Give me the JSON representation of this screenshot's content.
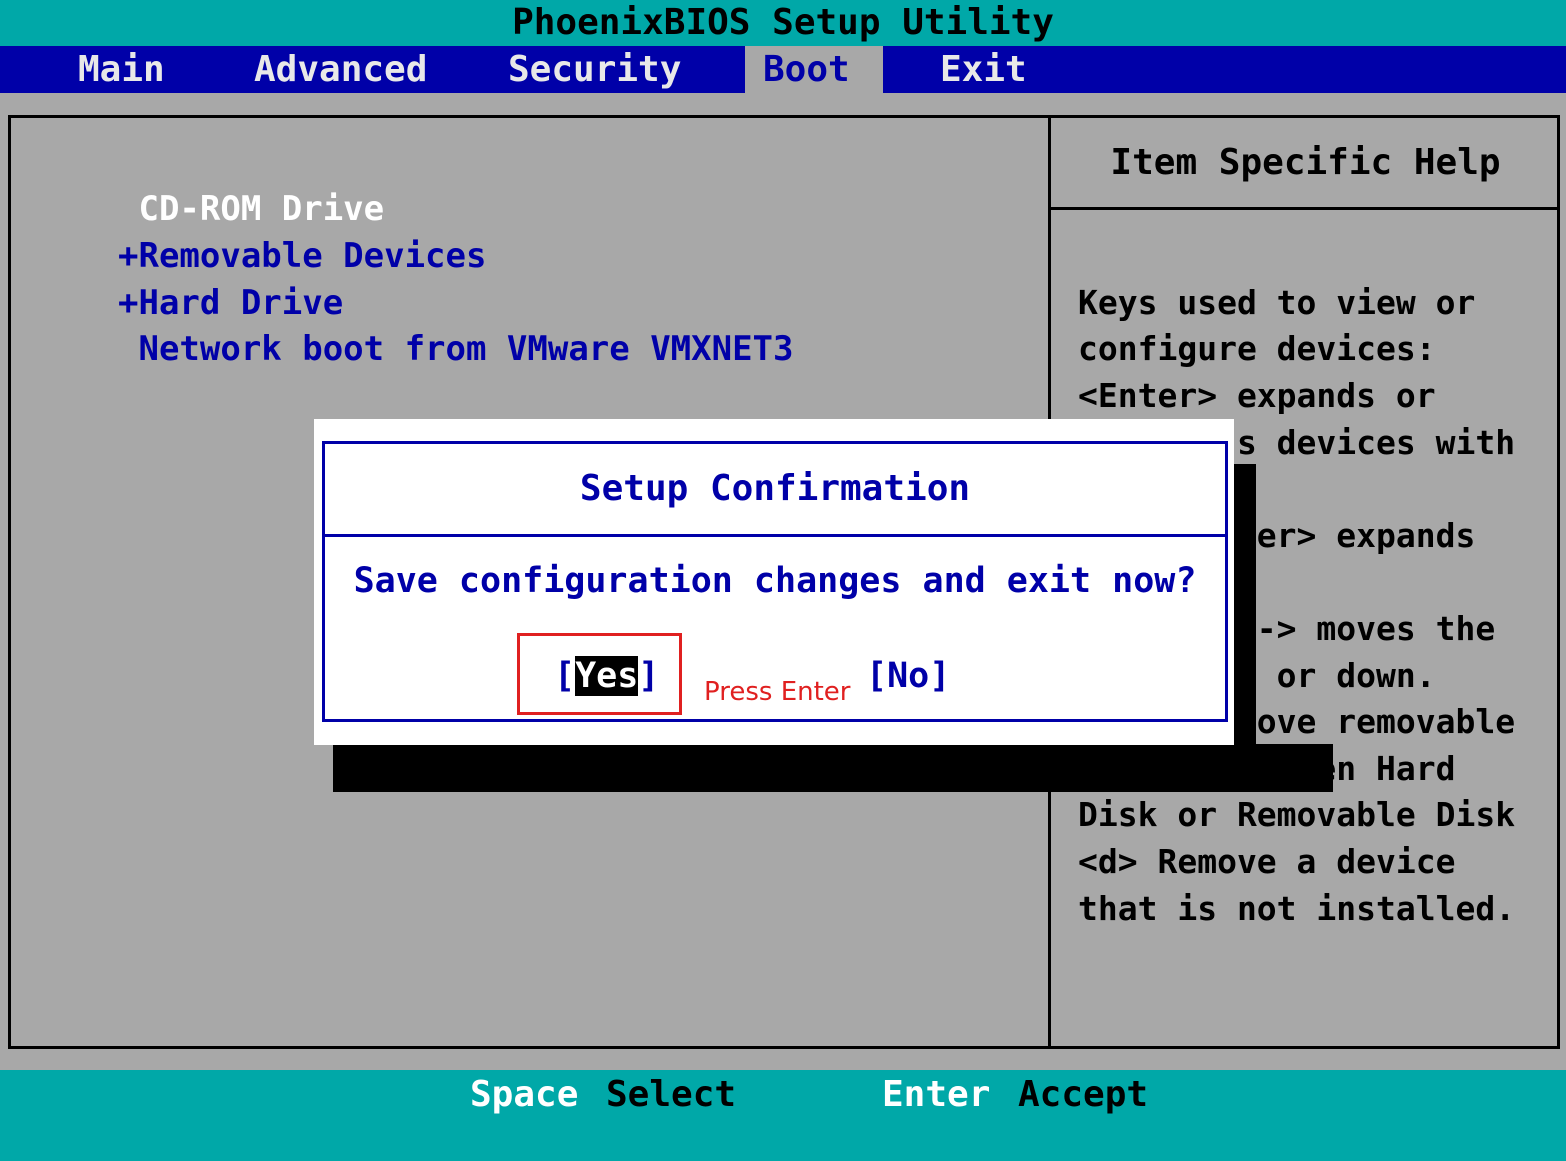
{
  "title": "PhoenixBIOS Setup Utility",
  "menu": [
    {
      "label": "Main"
    },
    {
      "label": "Advanced"
    },
    {
      "label": "Security"
    },
    {
      "label": "Boot"
    },
    {
      "label": "Exit"
    }
  ],
  "boot_items": [
    {
      "label": " CD-ROM Drive"
    },
    {
      "label": "+Removable Devices"
    },
    {
      "label": "+Hard Drive"
    },
    {
      "label": " Network boot from VMware VMXNET3"
    }
  ],
  "help": {
    "title": "Item Specific Help",
    "lines": [
      "Keys used to view or",
      "configure devices:",
      "<Enter> expands or",
      "        s devices with",
      "",
      "        ter> expands",
      "",
      "        <-> moves the",
      "        p or down.",
      "        move removable",
      "device between Hard",
      "Disk or Removable Disk",
      "<d> Remove a device",
      "that is not installed."
    ]
  },
  "dialog": {
    "title": "Setup Confirmation",
    "message": "Save configuration changes and exit now?",
    "yes_open": "[",
    "yes_label": "Yes",
    "yes_close": "]",
    "no_label": "[No]"
  },
  "annotation": {
    "text": "Press Enter"
  },
  "footer": [
    {
      "key": "Space",
      "desc": "Select"
    },
    {
      "key": "Enter",
      "desc": "Accept"
    }
  ]
}
